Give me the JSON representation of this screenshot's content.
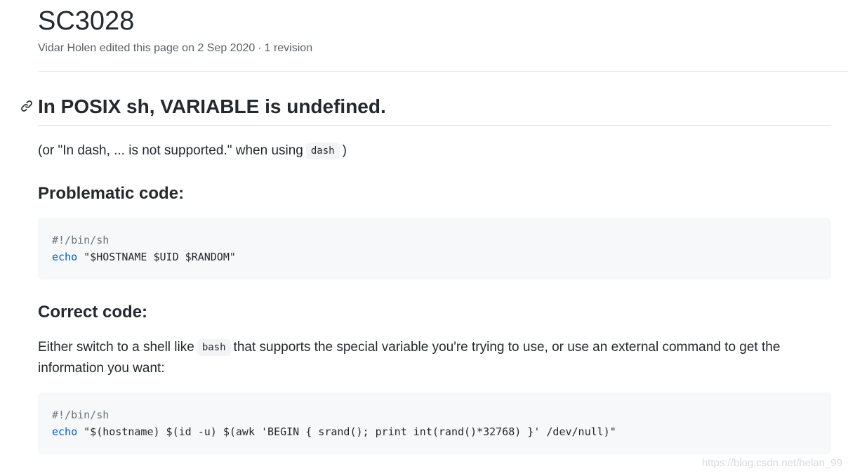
{
  "page": {
    "title": "SC3028",
    "meta": {
      "editor_text": "Vidar Holen edited this page on 2 Sep 2020",
      "separator": "·",
      "revisions": "1 revision"
    }
  },
  "heading": {
    "text": "In POSIX sh, VARIABLE is undefined.",
    "anchor_icon": "link-icon"
  },
  "note": {
    "before": "(or \"In dash, ... is not supported.\" when using",
    "code": "dash",
    "after": ")"
  },
  "problematic": {
    "heading": "Problematic code:",
    "code": {
      "shebang": "#!/bin/sh",
      "cmd": "echo",
      "args": " \"$HOSTNAME $UID $RANDOM\""
    }
  },
  "correct": {
    "heading": "Correct code:",
    "para_before": "Either switch to a shell like",
    "para_code": "bash",
    "para_after": "that supports the special variable you're trying to use, or use an external command to get the information you want:",
    "code": {
      "shebang": "#!/bin/sh",
      "cmd": "echo",
      "args": " \"$(hostname) $(id -u) $(awk 'BEGIN { srand(); print int(rand()*32768) }' /dev/null)\""
    }
  },
  "watermark": "https://blog.csdn.net/helan_99",
  "colors": {
    "text": "#24292e",
    "muted": "#586069",
    "code_bg": "#f6f8fa",
    "builtin": "#005cc5",
    "divider": "#e1e4e8"
  }
}
